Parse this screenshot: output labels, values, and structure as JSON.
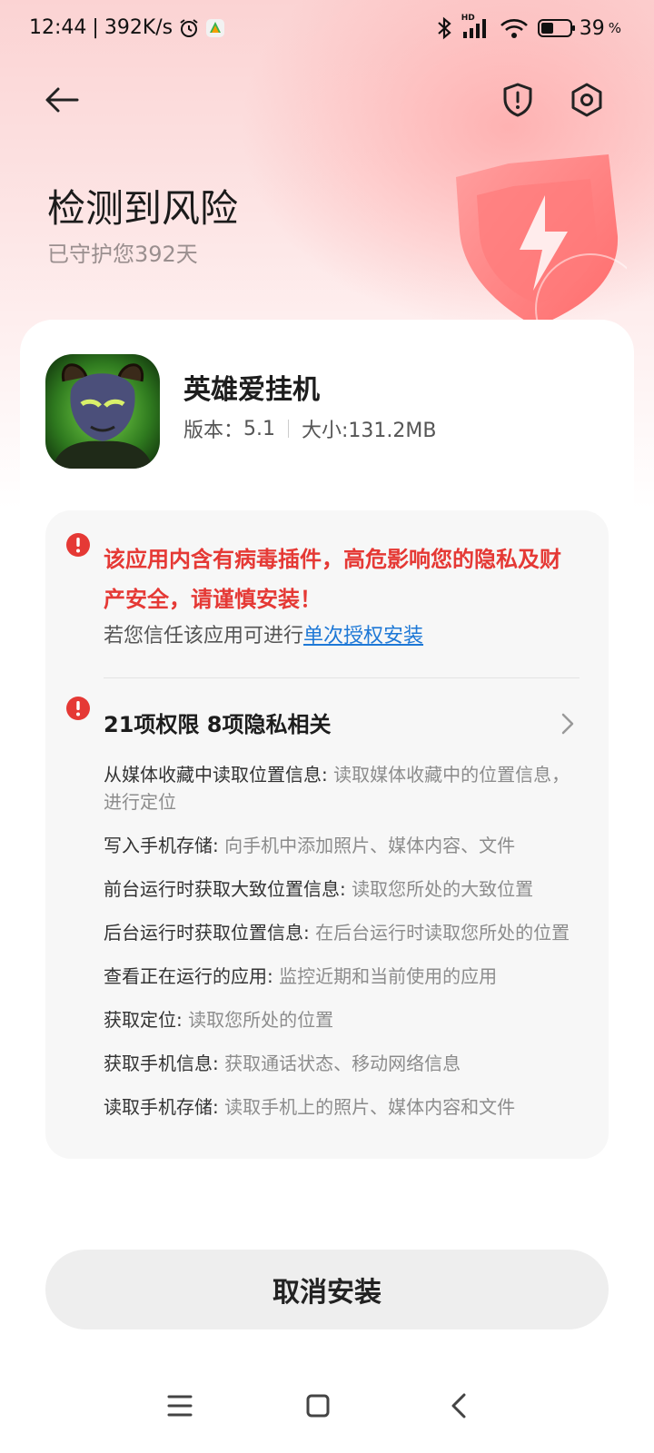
{
  "status_bar": {
    "time": "12:44",
    "speed": "392K/s",
    "battery": "39",
    "battery_unit": "%",
    "network_label": "HD"
  },
  "header": {
    "title": "检测到风险",
    "subtitle": "已守护您392天"
  },
  "app": {
    "name": "英雄爱挂机",
    "version_label": "版本：",
    "version": "5.1",
    "size_label": "大小:131.2MB"
  },
  "warning": {
    "text": "该应用内含有病毒插件，高危影响您的隐私及财产安全，请谨慎安装！",
    "trust_prefix": "若您信任该应用可进行",
    "trust_link": "单次授权安装"
  },
  "permissions": {
    "header": "21项权限 8项隐私相关",
    "items": [
      {
        "name": "从媒体收藏中读取位置信息:",
        "desc": " 读取媒体收藏中的位置信息，进行定位"
      },
      {
        "name": "写入手机存储:",
        "desc": " 向手机中添加照片、媒体内容、文件"
      },
      {
        "name": "前台运行时获取大致位置信息:",
        "desc": " 读取您所处的大致位置"
      },
      {
        "name": "后台运行时获取位置信息:",
        "desc": " 在后台运行时读取您所处的位置"
      },
      {
        "name": "查看正在运行的应用:",
        "desc": " 监控近期和当前使用的应用"
      },
      {
        "name": "获取定位:",
        "desc": " 读取您所处的位置"
      },
      {
        "name": "获取手机信息:",
        "desc": " 获取通话状态、移动网络信息"
      },
      {
        "name": "读取手机存储:",
        "desc": " 读取手机上的照片、媒体内容和文件"
      }
    ]
  },
  "actions": {
    "cancel_install": "取消安装"
  },
  "colors": {
    "danger": "#e53935",
    "link": "#1e78d6"
  }
}
